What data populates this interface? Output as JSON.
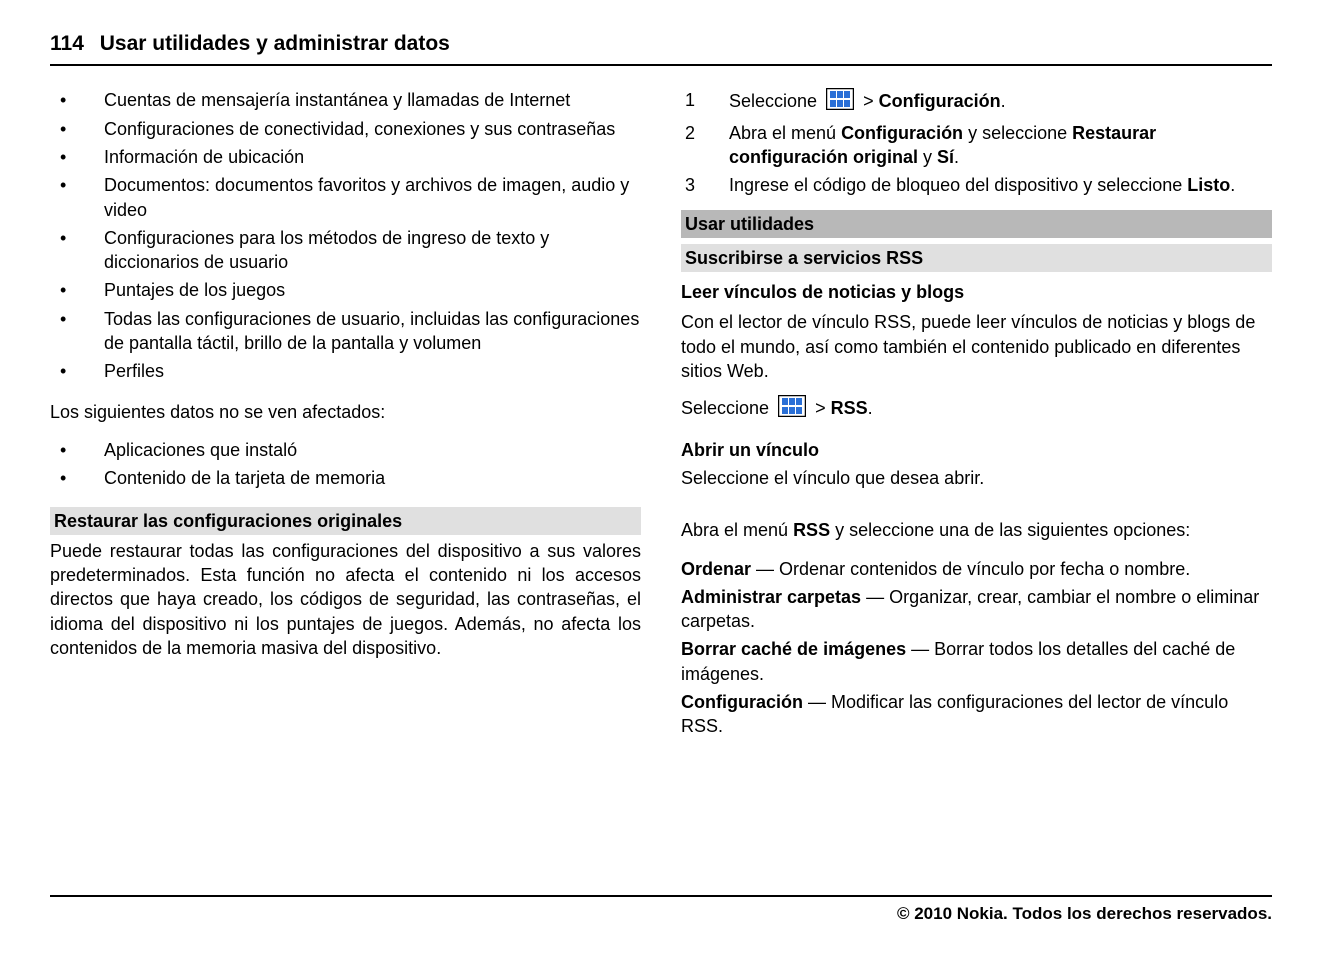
{
  "header": {
    "page_number": "114",
    "title": "Usar utilidades y administrar datos"
  },
  "left": {
    "bullets1": [
      "Cuentas de mensajería instantánea y llamadas de Internet",
      "Configuraciones de conectividad, conexiones y sus contraseñas",
      "Información de ubicación",
      "Documentos: documentos favoritos y archivos de imagen, audio y video",
      "Configuraciones para los métodos de ingreso de texto y diccionarios de usuario",
      "Puntajes de los juegos",
      "Todas las configuraciones de usuario, incluidas las configuraciones de pantalla táctil, brillo de la pantalla y volumen",
      "Perfiles"
    ],
    "para1": "Los siguientes datos no se ven afectados:",
    "bullets2": [
      "Aplicaciones que instaló",
      "Contenido de la tarjeta de memoria"
    ],
    "section_restore": {
      "title": "Restaurar las configuraciones originales",
      "body": "Puede restaurar todas las configuraciones del dispositivo a sus valores predeterminados. Esta función no afecta el contenido ni los accesos directos que haya creado, los códigos de seguridad, las contraseñas, el idioma del dispositivo ni los puntajes de juegos. Además, no afecta los contenidos de la memoria masiva del dispositivo."
    }
  },
  "right": {
    "steps": {
      "s1_a": "Seleccione ",
      "s1_b": " > ",
      "s1_c": "Configuración",
      "s1_d": ".",
      "s2_a": "Abra el menú ",
      "s2_b": "Configuración",
      "s2_c": " y seleccione ",
      "s2_d": "Restaurar configuración original",
      "s2_e": " y ",
      "s2_f": "Sí",
      "s2_g": ".",
      "s3_a": "Ingrese el código de bloqueo del dispositivo y seleccione ",
      "s3_b": "Listo",
      "s3_c": "."
    },
    "h_utilidades": "Usar utilidades",
    "h_rss": "Suscribirse a servicios RSS",
    "h_leer": "Leer vínculos de noticias y blogs",
    "rss_body": "Con el lector de vínculo RSS, puede leer vínculos de noticias y blogs de todo el mundo, así como también el contenido publicado en diferentes sitios Web.",
    "rss_select_a": "Seleccione ",
    "rss_select_b": " > ",
    "rss_select_c": "RSS",
    "rss_select_d": ".",
    "h_abrir": "Abrir un vínculo",
    "abrir_body": "Seleccione el vínculo que desea abrir.",
    "menu_intro_a": "Abra el menú ",
    "menu_intro_b": "RSS",
    "menu_intro_c": " y seleccione una de las siguientes opciones:",
    "opts": {
      "ordenar_t": "Ordenar",
      "ordenar_b": " — Ordenar contenidos de vínculo por fecha o nombre.",
      "admin_t": "Administrar carpetas",
      "admin_b": " — Organizar, crear, cambiar el nombre o eliminar carpetas.",
      "borrar_t": "Borrar caché de imágenes",
      "borrar_b": " — Borrar todos los detalles del caché de imágenes.",
      "config_t": "Configuración",
      "config_b": " — Modificar las configuraciones del lector de vínculo RSS."
    }
  },
  "footer": "© 2010 Nokia. Todos los derechos reservados."
}
